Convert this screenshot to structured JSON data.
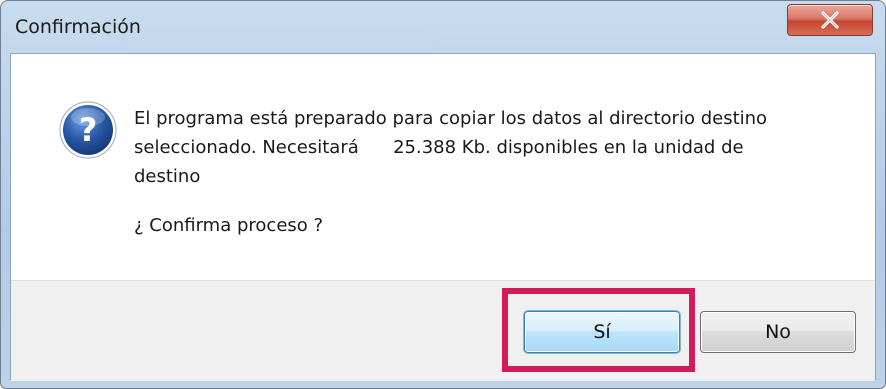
{
  "window": {
    "title": "Confirmación"
  },
  "icons": {
    "dialog_icon": "question-icon",
    "close": "close-icon"
  },
  "message": {
    "line1": "El programa está preparado para copiar los datos al directorio destino",
    "line2": "seleccionado. Necesitará      25.388 Kb. disponibles en la unidad de",
    "line3": "destino",
    "question": "¿ Confirma proceso ?"
  },
  "buttons": {
    "yes_label": "Sí",
    "no_label": "No"
  },
  "colors": {
    "highlight": "#d21c5a",
    "close_button": "#c7442f",
    "question_icon": "#2a5aa8"
  }
}
